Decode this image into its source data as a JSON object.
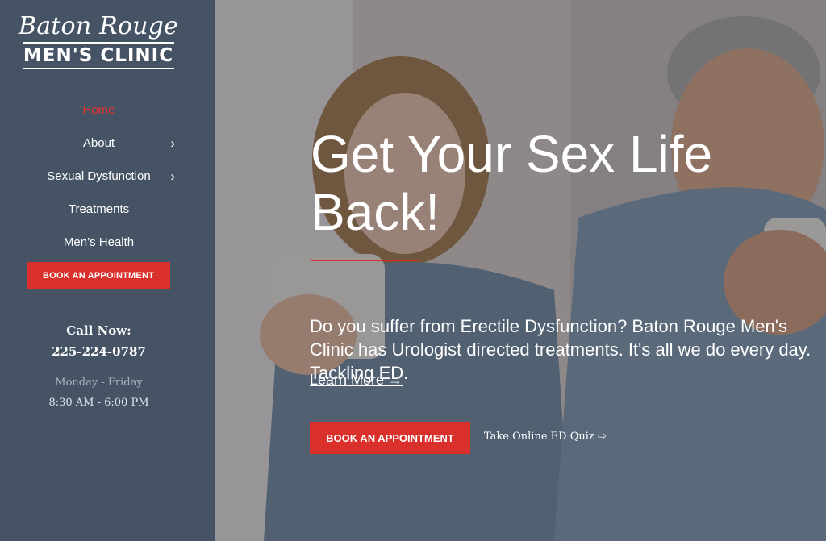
{
  "logo": {
    "line1": "Baton Rouge",
    "line2": "MEN'S CLINIC"
  },
  "nav": {
    "items": [
      {
        "label": "Home",
        "active": true,
        "has_submenu": false
      },
      {
        "label": "About",
        "active": false,
        "has_submenu": true
      },
      {
        "label": "Sexual Dysfunction",
        "active": false,
        "has_submenu": true
      },
      {
        "label": "Treatments",
        "active": false,
        "has_submenu": false
      },
      {
        "label": "Men’s Health",
        "active": false,
        "has_submenu": false
      }
    ],
    "chevron": "›",
    "book_label": "BOOK AN APPOINTMENT"
  },
  "contact": {
    "call_label": "Call Now:",
    "phone": "225-224-0787",
    "days": "Monday - Friday",
    "hours": "8:30 AM - 6:00 PM"
  },
  "hero": {
    "title": "Get Your Sex Life Back!",
    "text": "Do you suffer from Erectile Dysfunction? Baton Rouge Men's Clinic has Urologist directed treatments. It's all we do every day. Tackling ED.",
    "learn_more": "Learn More →",
    "book_label": "BOOK AN APPOINTMENT",
    "quiz_label": "Take Online ED Quiz ⇨"
  },
  "colors": {
    "sidebar": "#455365",
    "accent": "#d9302b",
    "active_nav": "#e2322e"
  },
  "icons": {
    "submenu": "chevron-right-icon",
    "quiz": "arrow-right-icon"
  }
}
